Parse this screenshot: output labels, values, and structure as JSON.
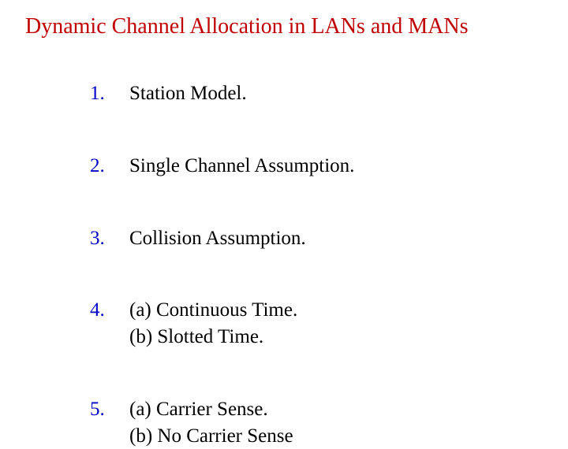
{
  "title": "Dynamic Channel Allocation in LANs and MANs",
  "items": [
    {
      "num": "1.",
      "lines": [
        "Station Model."
      ]
    },
    {
      "num": "2.",
      "lines": [
        "Single Channel Assumption."
      ]
    },
    {
      "num": "3.",
      "lines": [
        "Collision Assumption."
      ]
    },
    {
      "num": "4.",
      "lines": [
        "(a) Continuous Time.",
        "(b) Slotted Time."
      ]
    },
    {
      "num": "5.",
      "lines": [
        "(a) Carrier Sense.",
        "(b) No Carrier Sense"
      ]
    }
  ]
}
